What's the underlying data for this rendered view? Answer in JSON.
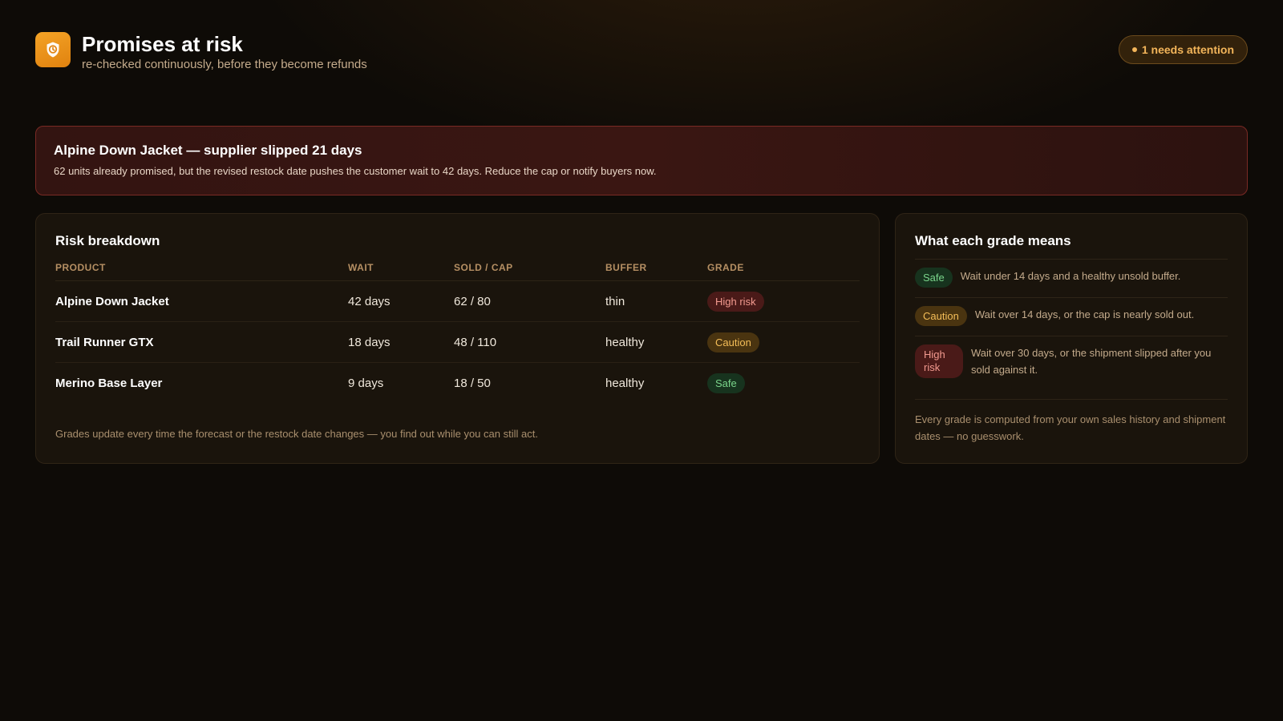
{
  "header": {
    "title": "Promises at risk",
    "subtitle": "re-checked continuously, before they become refunds",
    "logo_icon": "shield-clock-icon",
    "attention_label": "1 needs attention"
  },
  "alert": {
    "title": "Alpine Down Jacket — supplier slipped 21 days",
    "text": "62 units already promised, but the revised restock date pushes the customer wait to 42 days. Reduce the cap or notify buyers now."
  },
  "breakdown": {
    "title": "Risk breakdown",
    "columns": [
      "PRODUCT",
      "WAIT",
      "SOLD / CAP",
      "BUFFER",
      "GRADE"
    ],
    "rows": [
      {
        "product": "Alpine Down Jacket",
        "wait": "42 days",
        "sold_cap": "62 / 80",
        "buffer": "thin",
        "grade": "High risk"
      },
      {
        "product": "Trail Runner GTX",
        "wait": "18 days",
        "sold_cap": "48 / 110",
        "buffer": "healthy",
        "grade": "Caution"
      },
      {
        "product": "Merino Base Layer",
        "wait": "9 days",
        "sold_cap": "18 / 50",
        "buffer": "healthy",
        "grade": "Safe"
      }
    ],
    "footnote": "Grades update every time the forecast or the restock date changes — you find out while you can still act."
  },
  "legend": {
    "title": "What each grade means",
    "items": [
      {
        "grade": "Safe",
        "text": "Wait under 14 days and a healthy unsold buffer."
      },
      {
        "grade": "Caution",
        "text": "Wait over 14 days, or the cap is nearly sold out."
      },
      {
        "grade": "High risk",
        "text": "Wait over 30 days, or the shipment slipped after you sold against it."
      }
    ],
    "footnote": "Every grade is computed from your own sales history and shipment dates — no guesswork."
  },
  "colors": {
    "accent": "#f4a326",
    "high_risk": "#f39a8f",
    "caution": "#f5be58",
    "safe": "#7ad58b"
  }
}
